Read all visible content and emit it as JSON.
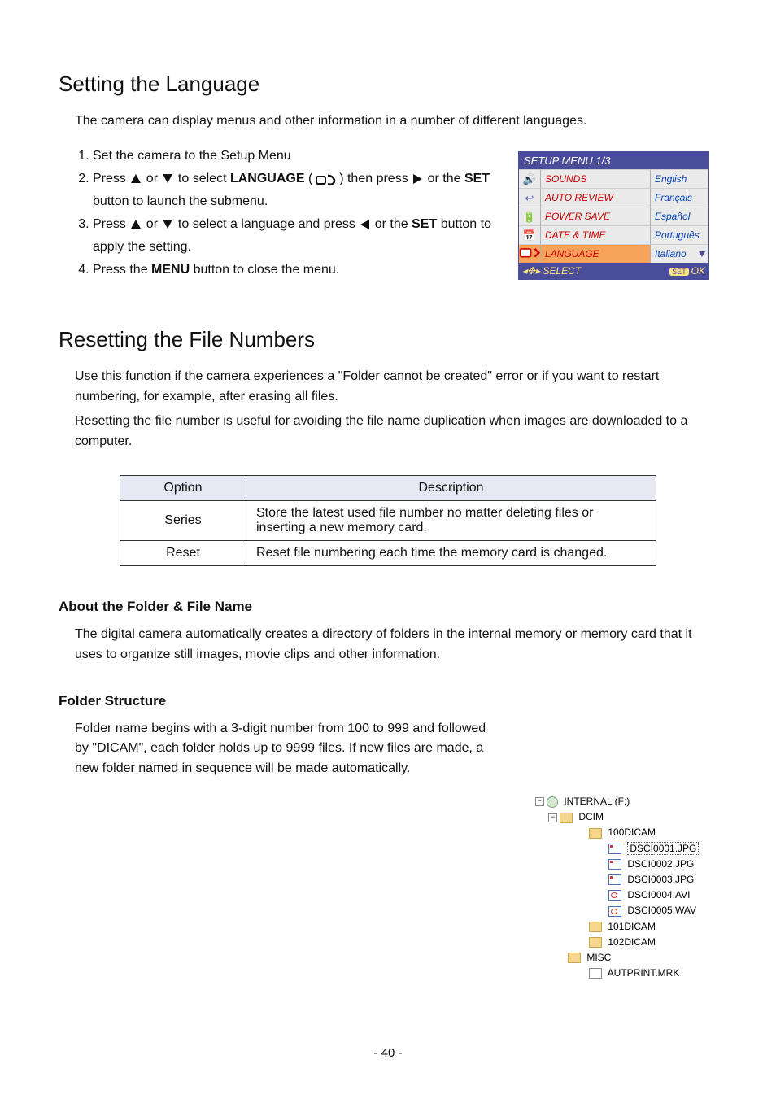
{
  "section1": {
    "title": "Setting the Language",
    "intro": "The camera can display menus and other information in a number of different languages.",
    "steps": {
      "s1": "Set the camera to the Setup Menu",
      "s2a": "Press ",
      "s2b": " or ",
      "s2c": " to select ",
      "s2_lang": "LANGUAGE",
      "s2d": " (",
      "s2e": ") then press ",
      "s2f": " or the ",
      "s2_set": "SET",
      "s2g": " button to launch the submenu.",
      "s3a": "Press ",
      "s3b": " or ",
      "s3c": " to select a language and press ",
      "s3d": " or the ",
      "s3_set": "SET",
      "s3e": " button to apply the setting.",
      "s4a": "Press the ",
      "s4_menu": "MENU",
      "s4b": " button to close the menu."
    }
  },
  "setup_menu": {
    "title": "SETUP MENU 1/3",
    "rows": [
      {
        "icon": "🔊",
        "label": "SOUNDS",
        "value": "English"
      },
      {
        "icon": "↩",
        "label": "AUTO REVIEW",
        "value": "Français"
      },
      {
        "icon": "🔋",
        "label": "POWER SAVE",
        "value": "Español"
      },
      {
        "icon": "📅",
        "label": "DATE & TIME",
        "value": "Português"
      },
      {
        "icon": "",
        "label": "LANGUAGE",
        "value": "Italiano",
        "selected": true
      }
    ],
    "footer_left": "SELECT",
    "footer_right": "OK",
    "footer_set": "SET"
  },
  "section2": {
    "title": "Resetting the File Numbers",
    "p1": "Use this function if the camera experiences a \"Folder cannot be created\" error or if you want to restart numbering, for example, after erasing all files.",
    "p2": "Resetting the file number is useful for avoiding the file name duplication when images are downloaded to a computer."
  },
  "table": {
    "h1": "Option",
    "h2": "Description",
    "r1c1": "Series",
    "r1c2": "Store the latest used file number no matter deleting files or inserting a new memory card.",
    "r2c1": "Reset",
    "r2c2": "Reset file numbering each time the memory card is changed."
  },
  "section3": {
    "title": "About the Folder & File Name",
    "p1": "The digital camera automatically creates a directory of folders in the internal memory or memory card that it uses to organize still images, movie clips and other information."
  },
  "section4": {
    "title": "Folder Structure",
    "p1": "Folder name begins with a 3-digit number from 100 to 999 and followed by \"DICAM\", each folder holds up to 9999 files. If new files are made, a new folder named in sequence will be made automatically."
  },
  "tree": {
    "root": "INTERNAL (F:)",
    "dcim": "DCIM",
    "f100": "100DICAM",
    "files": [
      "DSCI0001.JPG",
      "DSCI0002.JPG",
      "DSCI0003.JPG",
      "DSCI0004.AVI",
      "DSCI0005.WAV"
    ],
    "f101": "101DICAM",
    "f102": "102DICAM",
    "misc": "MISC",
    "autprint": "AUTPRINT.MRK"
  },
  "page_number": "- 40 -"
}
